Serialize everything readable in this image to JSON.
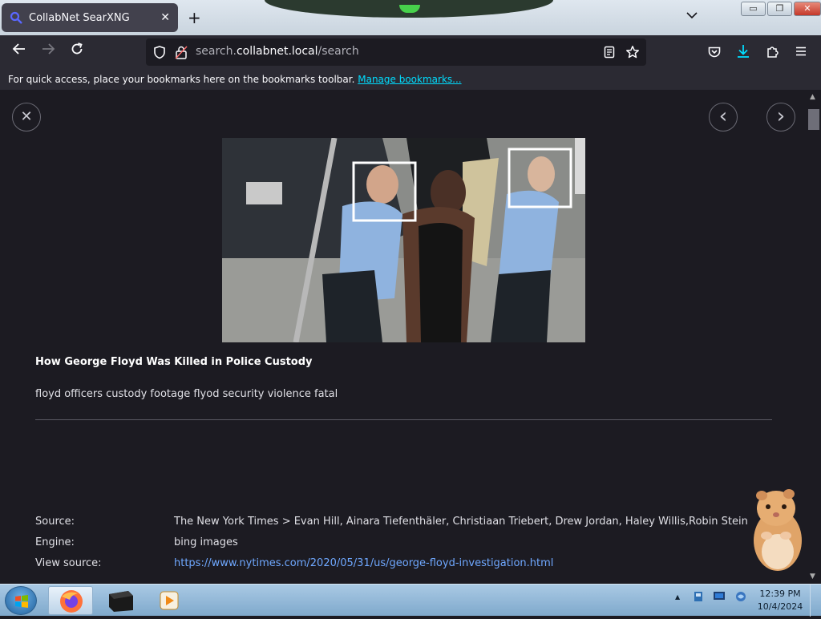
{
  "browser": {
    "tab_title": "CollabNet SearXNG",
    "tab_close": "✕",
    "new_tab": "+",
    "list_tabs": "⌄",
    "window_minimize": "▭",
    "window_restore": "❐",
    "window_close": "✕",
    "url_prefix": "search.",
    "url_domain": "collabnet.local",
    "url_path": "/search",
    "bookmarks_text": "For quick access, place your bookmarks here on the bookmarks toolbar.",
    "bookmarks_link": "Manage bookmarks..."
  },
  "result": {
    "title": "How George Floyd Was Killed in Police Custody",
    "description": "floyd officers custody footage flyod security violence fatal",
    "source_label": "Source:",
    "source_value": "The New York Times > Evan Hill, Ainara Tiefenthäler, Christiaan Triebert, Drew Jordan, Haley Willis,Robin Stein",
    "engine_label": "Engine:",
    "engine_value": "bing images",
    "view_source_label": "View source:",
    "view_source_value": "https://www.nytimes.com/2020/05/31/us/george-floyd-investigation.html"
  },
  "viewer": {
    "close": "✕",
    "prev": "‹",
    "next": "›"
  },
  "taskbar": {
    "time": "12:39 PM",
    "date": "10/4/2024",
    "tray_arrow": "▲"
  },
  "colors": {
    "page_bg": "#1c1b22",
    "toolbar_bg": "#2b2a33",
    "link": "#00ddff",
    "result_link": "#6fa8ff"
  }
}
